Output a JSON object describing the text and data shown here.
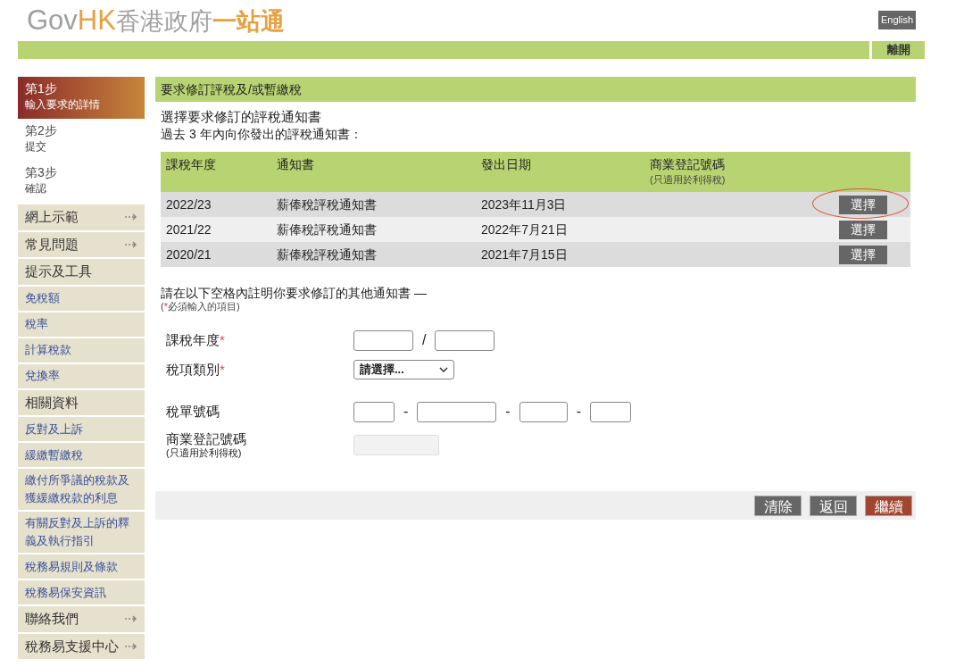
{
  "header": {
    "logo": {
      "part_1": "Gov",
      "part_2": "HK",
      "part_3": "香港政府",
      "part_4": "一站通"
    },
    "language_button": "English",
    "exit_button": "離開"
  },
  "sidebar": {
    "steps": [
      {
        "title": "第1步",
        "subtitle": "輸入要求的詳情",
        "selected": true
      },
      {
        "title": "第2步",
        "subtitle": "提交",
        "selected": false
      },
      {
        "title": "第3步",
        "subtitle": "確認",
        "selected": false
      }
    ],
    "items": [
      {
        "label": "網上示範",
        "kind": "section",
        "expandable": true
      },
      {
        "label": "常見問題",
        "kind": "section",
        "expandable": true
      },
      {
        "label": "提示及工具",
        "kind": "section",
        "expandable": false
      },
      {
        "label": "免稅額",
        "kind": "link",
        "expandable": false
      },
      {
        "label": "稅率",
        "kind": "link",
        "expandable": false
      },
      {
        "label": "計算稅款",
        "kind": "link",
        "expandable": false
      },
      {
        "label": "兌換率",
        "kind": "link",
        "expandable": false
      },
      {
        "label": "相關資料",
        "kind": "section",
        "expandable": false
      },
      {
        "label": "反對及上訴",
        "kind": "link",
        "expandable": false
      },
      {
        "label": "緩繳暫繳稅",
        "kind": "link",
        "expandable": false
      },
      {
        "label": "繳付所爭議的稅款及獲緩繳稅款的利息",
        "kind": "link",
        "expandable": false
      },
      {
        "label": "有關反對及上訴的釋義及執行指引",
        "kind": "link",
        "expandable": false
      },
      {
        "label": "稅務易規則及條款",
        "kind": "link",
        "expandable": false
      },
      {
        "label": "稅務易保安資訊",
        "kind": "link",
        "expandable": false
      },
      {
        "label": "聯絡我們",
        "kind": "section",
        "expandable": true
      },
      {
        "label": "稅務易支援中心",
        "kind": "section",
        "expandable": true
      }
    ]
  },
  "main": {
    "title": "要求修訂評稅及/或暫繳稅",
    "heading": "選擇要求修訂的評稅通知書",
    "subheading": "過去 3 年內向你發出的評稅通知書：",
    "table": {
      "columns": [
        "課稅年度",
        "通知書",
        "發出日期",
        "商業登記號碼"
      ],
      "column_note": "(只適用於利得稅)",
      "rows": [
        {
          "year": "2022/23",
          "notice": "薪俸稅評稅通知書",
          "date": "2023年11月3日",
          "button": "選擇",
          "highlighted": true
        },
        {
          "year": "2021/22",
          "notice": "薪俸稅評稅通知書",
          "date": "2022年7月21日",
          "button": "選擇",
          "highlighted": false
        },
        {
          "year": "2020/21",
          "notice": "薪俸稅評稅通知書",
          "date": "2021年7月15日",
          "button": "選擇",
          "highlighted": false
        }
      ]
    },
    "form_intro": "請在以下空格內註明你要求修訂的其他通知書 —",
    "required_note": {
      "open": "(",
      "mark": "*",
      "text": "必須輸入的項目)"
    },
    "form": [
      {
        "kind": "year",
        "label": "課稅年度",
        "required_mark": "*",
        "separator": "/"
      },
      {
        "kind": "select",
        "label": "稅項類別",
        "required_mark": "*",
        "value": "請選擇..."
      },
      {
        "kind": "number",
        "label": "稅單號碼",
        "separator": "-"
      },
      {
        "kind": "disabled",
        "label": "商業登記號碼",
        "note": "(只適用於利得稅)"
      }
    ],
    "buttons": [
      {
        "label": "清除",
        "kind": "secondary"
      },
      {
        "label": "返回",
        "kind": "secondary"
      },
      {
        "label": "繼續",
        "kind": "primary"
      }
    ]
  }
}
